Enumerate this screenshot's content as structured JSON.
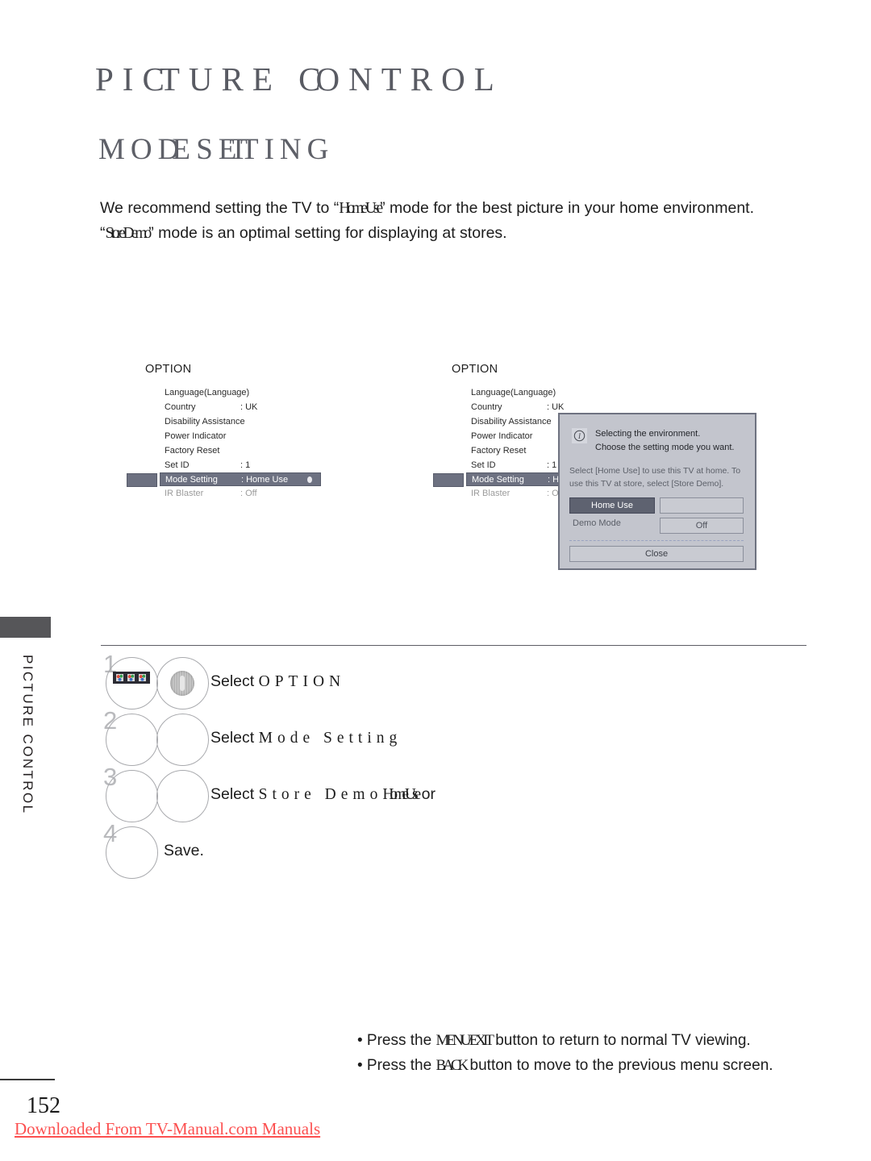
{
  "header": {
    "chapter_title_a": "PI",
    "chapter_title_b": "C",
    "chapter_title_c": "TURE ",
    "chapter_title_d": "C",
    "chapter_title_e": "ONTROL",
    "section_title_a": "MO",
    "section_title_b": "DE",
    "section_title_c": " S",
    "section_title_d": "ET",
    "section_title_e": "TING"
  },
  "intro": {
    "line1_pre": "We recommend setting the TV to “",
    "line1_emph": "Home Use",
    "line1_post": "” mode for the best picture in your home environment.",
    "line2_pre": "“",
    "line2_emph": "Store Demo",
    "line2_post": "” mode is an optimal setting for displaying at stores."
  },
  "osd_left": {
    "title": "OPTION",
    "rows": [
      {
        "label": "Language(Language)",
        "value": ""
      },
      {
        "label": "Country",
        "value": ": UK"
      },
      {
        "label": "Disability Assistance",
        "value": ""
      },
      {
        "label": "Power Indicator",
        "value": ""
      },
      {
        "label": "Factory Reset",
        "value": ""
      },
      {
        "label": "Set ID",
        "value": ": 1"
      },
      {
        "label": "Mode Setting",
        "value": ": Home Use"
      },
      {
        "label": "IR Blaster",
        "value": ": Off"
      }
    ]
  },
  "osd_right": {
    "title": "OPTION",
    "rows": [
      {
        "label": "Language(Language)",
        "value": ""
      },
      {
        "label": "Country",
        "value": ": UK"
      },
      {
        "label": "Disability Assistance",
        "value": ""
      },
      {
        "label": "Power Indicator",
        "value": ""
      },
      {
        "label": "Factory Reset",
        "value": ""
      },
      {
        "label": "Set ID",
        "value": ": 1"
      },
      {
        "label": "Mode Setting",
        "value": ": Hom"
      },
      {
        "label": "IR Blaster",
        "value": ": Off"
      }
    ]
  },
  "dialog": {
    "info_icon": "info-icon",
    "head_line1": "Selecting the environment.",
    "head_line2": "Choose the setting mode you want.",
    "body": "Select [Home Use] to use this TV at home. To use this TV at store, select [Store Demo].",
    "home_use_label": "Home Use",
    "store_demo_label": "",
    "demo_mode_label": "Demo Mode",
    "demo_mode_value": "Off",
    "close_label": "Close"
  },
  "sidebar": {
    "label": "PICTURE CONTROL"
  },
  "steps": [
    {
      "num": "1",
      "text_pre": "Select ",
      "text_emph": "OPTION",
      "text_post": ""
    },
    {
      "num": "2",
      "text_pre": "Select ",
      "text_emph": "Mode Setting",
      "text_post": ""
    },
    {
      "num": "3",
      "text_pre": "Select ",
      "text_emph": "Store Demo",
      "text_mid": " or ",
      "text_emph2": "Home Use",
      "text_post": ""
    },
    {
      "num": "4",
      "text_pre": "Save.",
      "text_emph": "",
      "text_post": ""
    }
  ],
  "notes": {
    "note1_pre": "• Press the ",
    "note1_key": "MENU/EXIT",
    "note1_post": " button to return to normal TV viewing.",
    "note2_pre": "• Press the ",
    "note2_key": "BACK",
    "note2_post": " button to move to the previous menu screen."
  },
  "footer": {
    "page_number": "152",
    "download_text": "Downloaded From TV-Manual.com Manuals"
  },
  "colors": {
    "osd_highlight": "#6d7181",
    "dialog_bg": "#c3c5cd",
    "link_red": "#fc5050",
    "sidebar_tab": "#565659"
  }
}
